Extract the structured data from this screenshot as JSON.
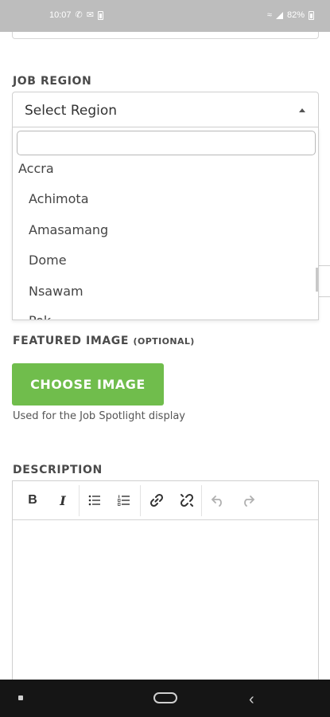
{
  "status_bar": {
    "time": "10:07",
    "battery": "82%",
    "icons": [
      "whatsapp-icon",
      "mail-icon",
      "battery-small-icon",
      "wifi-icon",
      "signal-icon",
      "battery-icon"
    ]
  },
  "job_region": {
    "label": "JOB REGION",
    "select_placeholder": "Select Region",
    "dropdown": {
      "search_value": "",
      "group": "Accra",
      "options": [
        "Achimota",
        "Amasamang",
        "Dome",
        "Nsawam",
        "Pok..."
      ]
    }
  },
  "featured_image": {
    "label": "FEATURED IMAGE",
    "label_suffix": "(OPTIONAL)",
    "button_label": "CHOOSE IMAGE",
    "help_text": "Used for the Job Spotlight display"
  },
  "description": {
    "label": "DESCRIPTION",
    "toolbar": [
      "bold-icon",
      "italic-icon",
      "bullet-list-icon",
      "numbered-list-icon",
      "link-icon",
      "unlink-icon",
      "undo-icon",
      "redo-icon"
    ],
    "content": ""
  },
  "colors": {
    "button_green": "#70bd4c",
    "status_bar": "#bdbdbd",
    "nav_bar": "#151515"
  }
}
